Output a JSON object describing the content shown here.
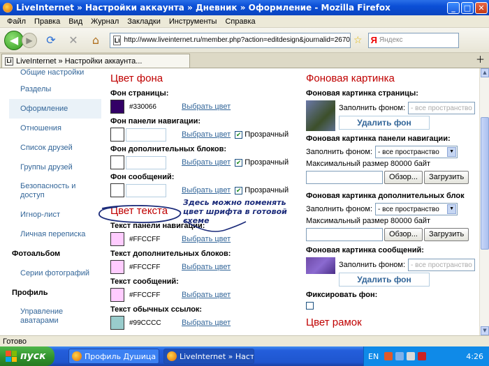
{
  "window": {
    "title": "LiveInternet » Настройки аккаунта » Дневник » Оформление - Mozilla Firefox"
  },
  "menu": [
    "Файл",
    "Правка",
    "Вид",
    "Журнал",
    "Закладки",
    "Инструменты",
    "Справка"
  ],
  "nav": {
    "url": "http://www.liveinternet.ru/member.php?action=editdesign&journalid=2670",
    "url_favicon": "Li",
    "search_placeholder": "Яндекс",
    "search_logo": "Я"
  },
  "tab": {
    "label": "LiveInternet » Настройки аккаунта...",
    "favicon": "Li"
  },
  "sidebar": {
    "items": [
      {
        "label": "Общие настройки"
      },
      {
        "label": "Разделы"
      },
      {
        "label": "Оформление"
      },
      {
        "label": "Отношения"
      },
      {
        "label": "Список друзей"
      },
      {
        "label": "Группы друзей"
      },
      {
        "label": "Безопасность и доступ"
      },
      {
        "label": "Игнор-лист"
      },
      {
        "label": "Личная переписка"
      }
    ],
    "photo_head": "Фотоальбом",
    "photo_item": "Серии фотографий",
    "profile_head": "Профиль",
    "profile_item": "Управление аватарами"
  },
  "bg_color": {
    "title": "Цвет фона",
    "page_label": "Фон страницы:",
    "page_value": "#330066",
    "page_color": "#330066",
    "nav_label": "Фон панели навигации:",
    "extra_label": "Фон дополнительных блоков:",
    "msg_label": "Фон сообщений:",
    "pick": "Выбрать цвет",
    "transparent": "Прозрачный"
  },
  "text_color": {
    "title": "Цвет текста",
    "nav_label": "Текст панели навигации:",
    "nav_value": "#FFCCFF",
    "extra_label": "Текст дополнительных блоков:",
    "extra_value": "#FFCCFF",
    "msg_label": "Текст сообщений:",
    "msg_value": "#FFCCFF",
    "links_label": "Текст обычных ссылок:",
    "links_value": "#99CCCC",
    "pink": "#FFCCFF",
    "teal": "#99CCCC"
  },
  "annotation": "Здесь можно поменять цвет шрифта в готовой схеме",
  "bg_image": {
    "title": "Фоновая картинка",
    "page_label": "Фоновая картинка страницы:",
    "fill_label": "Заполнить фоном:",
    "fill_value_disabled": "- все пространство",
    "fill_value": "- все пространство",
    "delete_btn": "Удалить фон",
    "nav_label": "Фоновая картинка панели навигации:",
    "max_size": "Максимальный размер 80000 байт",
    "browse_btn": "Обзор...",
    "upload_btn": "Загрузить",
    "extra_label": "Фоновая картинка дополнительных блок",
    "msg_label": "Фоновая картинка сообщений:",
    "fix_label": "Фиксировать фон:"
  },
  "frame_color": {
    "title": "Цвет рамок"
  },
  "status": "Готово",
  "taskbar": {
    "start": "пуск",
    "task1": "Профиль Душица - ...",
    "task2": "LiveInternet » Настр...",
    "lang": "EN",
    "clock": "4:26"
  }
}
